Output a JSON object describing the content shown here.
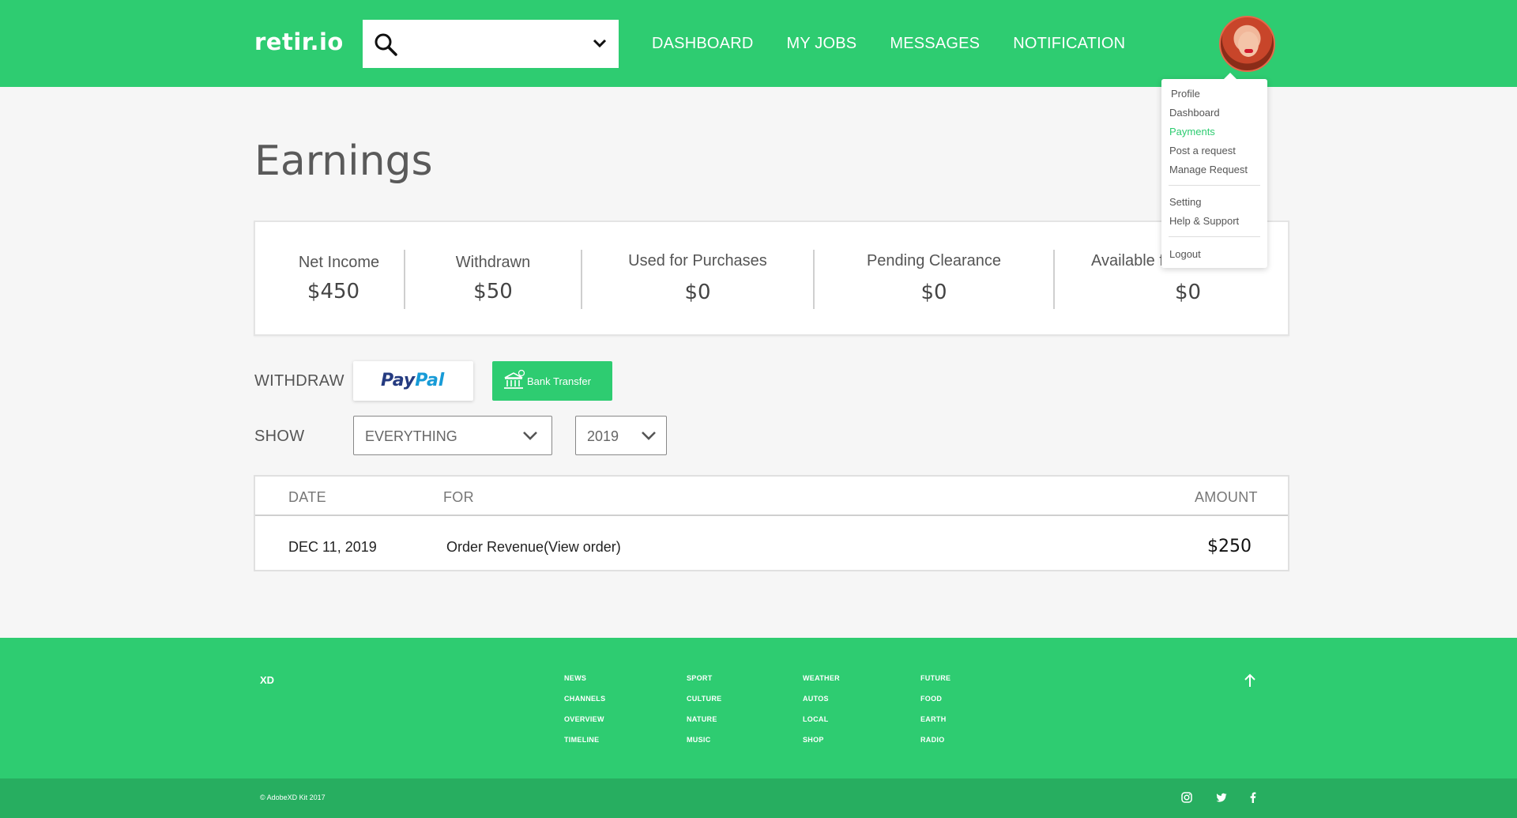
{
  "header": {
    "logo": "retir.io",
    "search_placeholder": "",
    "nav": [
      "DASHBOARD",
      "MY JOBS",
      "MESSAGES",
      "NOTIFICATION"
    ]
  },
  "menu": {
    "items": [
      "Profile",
      "Dashboard",
      "Payments",
      "Post a request",
      "Manage Request",
      "Setting",
      "Help & Support",
      "Logout"
    ],
    "active": "Payments"
  },
  "page_title": "Earnings",
  "stats": [
    {
      "label": "Net Income",
      "value": "$450"
    },
    {
      "label": "Withdrawn",
      "value": "$50"
    },
    {
      "label": "Used for Purchases",
      "value": "$0"
    },
    {
      "label": "Pending Clearance",
      "value": "$0"
    },
    {
      "label": "Available f",
      "value": "$0"
    }
  ],
  "withdraw": {
    "label": "WITHDRAW",
    "paypal_part1": "Pay",
    "paypal_part2": "Pal",
    "bank_transfer": "Bank Transfer"
  },
  "show": {
    "label": "SHOW",
    "filter_value": "EVERYTHING",
    "year_value": "2019"
  },
  "table": {
    "headers": {
      "date": "DATE",
      "for": "FOR",
      "amount": "AMOUNT"
    },
    "rows": [
      {
        "date": "DEC 11, 2019",
        "for": "Order Revenue(View order)",
        "amount": "$250"
      }
    ]
  },
  "footer": {
    "brand": "XD",
    "columns": [
      [
        "NEWS",
        "CHANNELS",
        "OVERVIEW",
        "TIMELINE"
      ],
      [
        "SPORT",
        "CULTURE",
        "NATURE",
        "MUSIC"
      ],
      [
        "WEATHER",
        "AUTOS",
        "LOCAL",
        "SHOP"
      ],
      [
        "FUTURE",
        "FOOD",
        "EARTH",
        "RADIO"
      ]
    ],
    "copyright": "© AdobeXD Kit 2017"
  },
  "colors": {
    "brand_green": "#2ecc71",
    "footer_dark_green": "#27ae60",
    "paypal_dark": "#253b80",
    "paypal_light": "#179bd7"
  },
  "icons": [
    "search-icon",
    "chevron-down-icon",
    "bank-icon",
    "arrow-up-icon",
    "instagram-icon",
    "twitter-icon",
    "facebook-icon"
  ]
}
